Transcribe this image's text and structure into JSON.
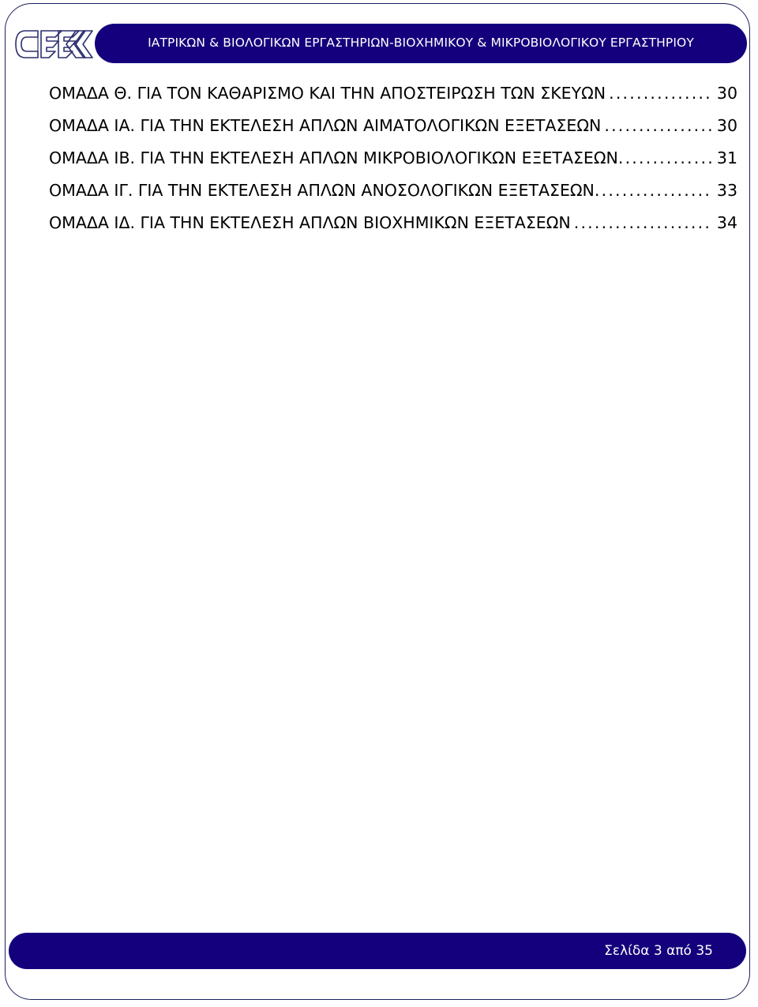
{
  "header": {
    "logo_text": "CEEK",
    "logo_icon": "ceek-logo-icon",
    "title": "ΙΑΤΡΙΚΩΝ & ΒΙΟΛΟΓΙΚΩΝ ΕΡΓΑΣΤΗΡΙΩΝ-ΒΙΟΧΗΜΙΚΟΥ & ΜΙΚΡΟΒΙΟΛΟΓΙΚΟΥ ΕΡΓΑΣΤΗΡΙΟΥ"
  },
  "toc": {
    "entries": [
      {
        "label": "ΟΜΑΔΑ  Θ. ΓΙΑ  ΤΟΝ ΚΑΘΑΡΙΣΜΟ ΚΑΙ ΤΗΝ ΑΠΟΣΤΕΙΡΩΣΗ ΤΩΝ ΣΚΕΥΩΝ",
        "leader": "................................................................",
        "page": "30"
      },
      {
        "label": "ΟΜΑΔΑ  ΙΑ. ΓΙΑ ΤΗΝ ΕΚΤΕΛΕΣΗ ΑΠΛΩΝ ΑΙΜΑΤΟΛΟΓΙΚΩΝ ΕΞΕΤΑΣΕΩΝ",
        "leader": "................................................................",
        "page": "30"
      },
      {
        "label": "ΟΜΑΔΑ  ΙΒ. ΓΙΑ ΤΗΝ ΕΚΤΕΛΕΣΗ ΑΠΛΩΝ ΜΙΚΡΟΒΙΟΛΟΓΙΚΩΝ ΕΞΕΤΑΣΕΩΝ",
        "leader": "................................................................",
        "page": "31"
      },
      {
        "label": "ΟΜΑΔΑ  ΙΓ. ΓΙΑ ΤΗΝ ΕΚΤΕΛΕΣΗ ΑΠΛΩΝ ΑΝΟΣΟΛΟΓΙΚΩΝ ΕΞΕΤΑΣΕΩΝ",
        "leader": "................................................................",
        "page": "33"
      },
      {
        "label": "ΟΜΑΔΑ  ΙΔ. ΓΙΑ ΤΗΝ ΕΚΤΕΛΕΣΗ ΑΠΛΩΝ ΒΙΟΧΗΜΙΚΩΝ ΕΞΕΤΑΣΕΩΝ",
        "leader": "................................................................",
        "page": "34"
      }
    ]
  },
  "footer": {
    "page_label": "Σελίδα 3 από 35"
  },
  "colors": {
    "brand_navy": "#14007c",
    "border_navy": "#1b1f5c",
    "text": "#000000",
    "on_brand": "#ffffff"
  }
}
